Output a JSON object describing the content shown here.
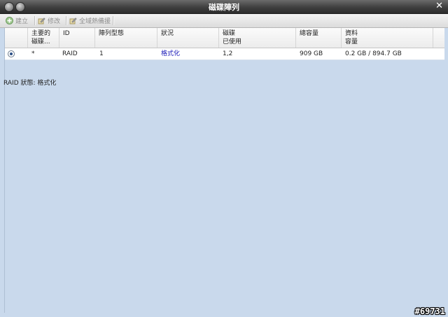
{
  "window": {
    "title": "磁碟陣列",
    "close_glyph": "✕"
  },
  "toolbar": {
    "create_label": "建立",
    "modify_label": "修改",
    "global_spare_label": "全域熱備援"
  },
  "table": {
    "headers": [
      {
        "line1": "",
        "line2": ""
      },
      {
        "line1": "主要的",
        "line2": "磁碟..."
      },
      {
        "line1": "ID",
        "line2": ""
      },
      {
        "line1": "陣列型態",
        "line2": ""
      },
      {
        "line1": "狀況",
        "line2": ""
      },
      {
        "line1": "磁碟",
        "line2": "已使用"
      },
      {
        "line1": "總容量",
        "line2": ""
      },
      {
        "line1": "資料",
        "line2": "容量"
      }
    ],
    "rows": [
      {
        "selected": true,
        "primary": "*",
        "id": "RAID",
        "type": "1",
        "status": "格式化",
        "disks_used": "1,2",
        "total_capacity": "909 GB",
        "data_capacity": "0.2 GB / 894.7 GB"
      }
    ]
  },
  "status_text": "RAID 狀態: 格式化",
  "watermark": "#69731",
  "colors": {
    "status_link": "#1a1ab8",
    "background": "#c9d9ec"
  }
}
